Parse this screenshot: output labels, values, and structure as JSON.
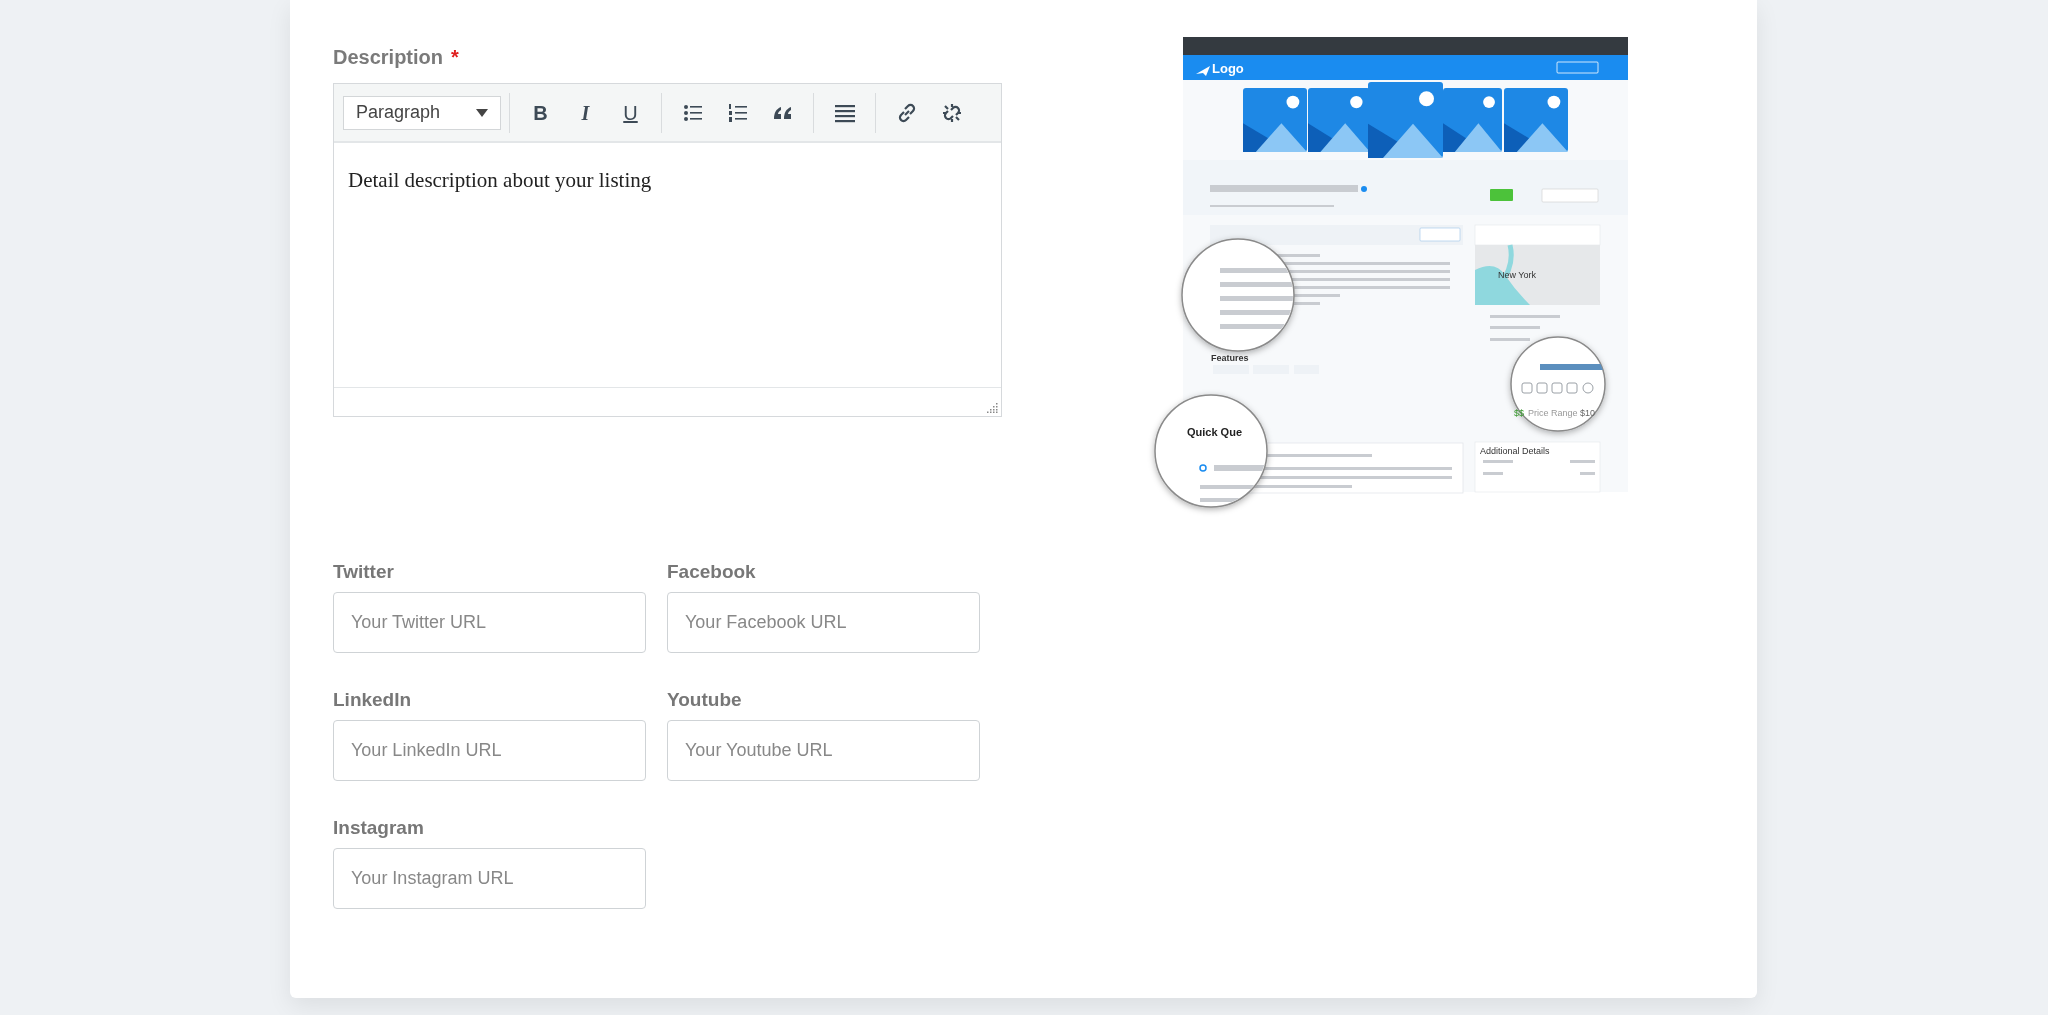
{
  "description": {
    "label": "Description",
    "required_mark": "*",
    "format": "Paragraph",
    "tool_groups": [
      [
        {
          "kind": "bold",
          "glyph": "B"
        },
        {
          "kind": "italic",
          "glyph": "I"
        },
        {
          "kind": "underline",
          "glyph": "U"
        }
      ],
      [
        {
          "kind": "bullet_list"
        },
        {
          "kind": "numbered_list"
        },
        {
          "kind": "blockquote"
        }
      ],
      [
        {
          "kind": "justify"
        }
      ],
      [
        {
          "kind": "link"
        },
        {
          "kind": "unlink"
        }
      ]
    ],
    "content": "Detail description about your listing"
  },
  "social_fields": [
    {
      "label": "Twitter",
      "placeholder": "Your Twitter URL"
    },
    {
      "label": "Facebook",
      "placeholder": "Your Facebook URL"
    },
    {
      "label": "LinkedIn",
      "placeholder": "Your LinkedIn URL"
    },
    {
      "label": "Youtube",
      "placeholder": "Your Youtube URL"
    },
    {
      "label": "Instagram",
      "placeholder": "Your Instagram URL"
    }
  ],
  "preview": {
    "logo": "Logo",
    "features_heading": "Features",
    "map_label": "New York",
    "questions_heading": "Quick Que",
    "price_symbol": "$$",
    "price_label": "Price Range",
    "price_value": "$10",
    "details_heading": "Additional Details"
  }
}
